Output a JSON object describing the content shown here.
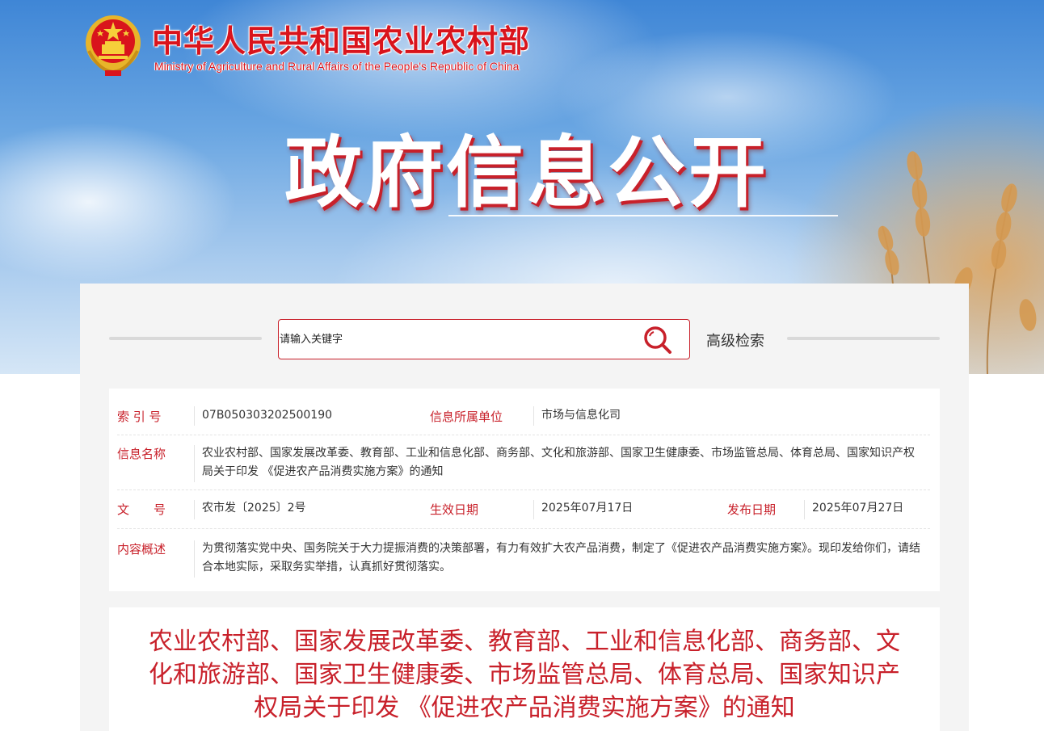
{
  "header": {
    "ministry_cn": "中华人民共和国农业农村部",
    "ministry_en": "Ministry of Agriculture and Rural Affairs of the People's Republic of China",
    "section_title": "政府信息公开"
  },
  "search": {
    "placeholder": "请输入关键字",
    "advanced_label": "高级检索"
  },
  "info": {
    "index_label": "索 引 号",
    "index_value": "07B050303202500190",
    "unit_label": "信息所属单位",
    "unit_value": "市场与信息化司",
    "name_label": "信息名称",
    "name_value": "农业农村部、国家发展改革委、教育部、工业和信息化部、商务部、文化和旅游部、国家卫生健康委、市场监管总局、体育总局、国家知识产权局关于印发 《促进农产品消费实施方案》的通知",
    "docno_label": "文　　号",
    "docno_value": "农市发〔2025〕2号",
    "effective_label": "生效日期",
    "effective_value": "2025年07月17日",
    "publish_label": "发布日期",
    "publish_value": "2025年07月27日",
    "summary_label": "内容概述",
    "summary_value": "为贯彻落实党中央、国务院关于大力提振消费的决策部署，有力有效扩大农产品消费，制定了《促进农产品消费实施方案》。现印发给你们，请结合本地实际，采取务实举措，认真抓好贯彻落实。"
  },
  "article": {
    "title": "农业农村部、国家发展改革委、教育部、工业和信息化部、商务部、文化和旅游部、国家卫生健康委、市场监管总局、体育总局、国家知识产权局关于印发 《促进农产品消费实施方案》的通知"
  },
  "colors": {
    "brand_red": "#c8202a",
    "panel_bg": "#f4f4f4"
  },
  "icons": [
    "national-emblem-icon",
    "search-icon"
  ]
}
